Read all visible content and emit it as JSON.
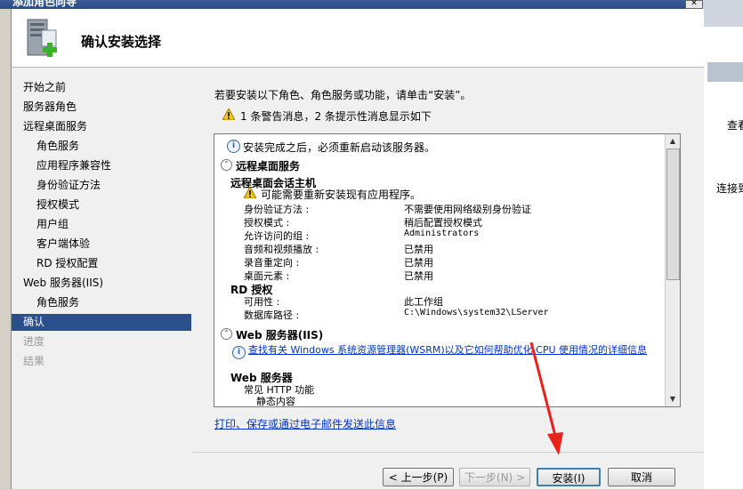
{
  "window": {
    "title": "添加角色向导",
    "close_label": "✕"
  },
  "header": {
    "title": "确认安装选择"
  },
  "nav": {
    "items": [
      {
        "label": "开始之前",
        "state": "normal"
      },
      {
        "label": "服务器角色",
        "state": "normal"
      },
      {
        "label": "远程桌面服务",
        "state": "normal"
      },
      {
        "label": "角色服务",
        "state": "sub"
      },
      {
        "label": "应用程序兼容性",
        "state": "sub"
      },
      {
        "label": "身份验证方法",
        "state": "sub"
      },
      {
        "label": "授权模式",
        "state": "sub"
      },
      {
        "label": "用户组",
        "state": "sub"
      },
      {
        "label": "客户端体验",
        "state": "sub"
      },
      {
        "label": "RD 授权配置",
        "state": "sub"
      },
      {
        "label": "Web 服务器(IIS)",
        "state": "normal"
      },
      {
        "label": "角色服务",
        "state": "sub"
      },
      {
        "label": "确认",
        "state": "selected"
      },
      {
        "label": "进度",
        "state": "disabled"
      },
      {
        "label": "结果",
        "state": "disabled"
      }
    ]
  },
  "content": {
    "intro": "若要安装以下角色、角色服务或功能，请单击“安装”。",
    "warning_summary": "1 条警告消息，2 条提示性消息显示如下",
    "list": {
      "restart_info": "安装完成之后，必须重新启动该服务器。",
      "rds_section": "远程桌面服务",
      "session_host": "远程桌面会话主机",
      "reinstall_warning": "可能需要重新安装现有应用程序。",
      "props": [
        {
          "label": "身份验证方法 :",
          "value": "不需要使用网络级别身份验证"
        },
        {
          "label": "授权模式 :",
          "value": "稍后配置授权模式"
        },
        {
          "label": "允许访问的组 :",
          "value": "Administrators"
        },
        {
          "label": "音频和视频播放 :",
          "value": "已禁用"
        },
        {
          "label": "录音重定向 :",
          "value": "已禁用"
        },
        {
          "label": "桌面元素 :",
          "value": "已禁用"
        }
      ],
      "rd_licensing": "RD 授权",
      "licensing_props": [
        {
          "label": "可用性 :",
          "value": "此工作组"
        },
        {
          "label": "数据库路径 :",
          "value": "C:\\Windows\\system32\\LServer"
        }
      ],
      "web_section": "Web 服务器(IIS)",
      "wsrm_link": "查找有关 Windows 系统资源管理器(WSRM)以及它如何帮助优化 CPU 使用情况的详细信息",
      "web_server": "Web 服务器",
      "http_features": "常见 HTTP 功能",
      "static_content": "静态内容"
    },
    "footer_link": "打印、保存或通过电子邮件发送此信息"
  },
  "buttons": {
    "prev": "< 上一步(P)",
    "next": "下一步(N) >",
    "install": "安装(I)",
    "cancel": "取消"
  },
  "background_window": {
    "text1": "查看",
    "text2": "连接到"
  },
  "colors": {
    "nav_selected": "#2b4f8a",
    "arrow": "#e8221b",
    "link": "#0033cc"
  }
}
